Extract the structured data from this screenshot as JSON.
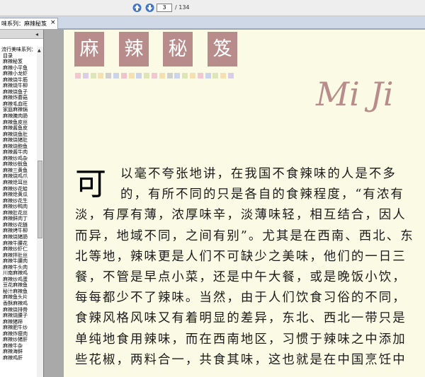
{
  "toolbar": {
    "page_current": "3",
    "page_total": "/ 134",
    "prev_icon": "up-arrow-icon",
    "next_icon": "down-arrow-icon"
  },
  "tab": {
    "label": "味系列：麻辣秘笈",
    "close": "×"
  },
  "sidebar": {
    "collapse": "◂",
    "items": [
      {
        "label": "流行美味系列："
      },
      {
        "label": "目录"
      },
      {
        "label": "麻辣秘笈"
      },
      {
        "label": "麻辣小平鱼"
      },
      {
        "label": "麻辣小龙虾"
      },
      {
        "label": "麻辣烧牛筋"
      },
      {
        "label": "麻辣烧牛柳"
      },
      {
        "label": "麻辣烧鱼子"
      },
      {
        "label": "麻辣炸蘑菇"
      },
      {
        "label": "麻辣毛血旺"
      },
      {
        "label": "家庭麻辣锅"
      },
      {
        "label": "麻辣腌肉肠"
      },
      {
        "label": "麻辣鱼皮丝"
      },
      {
        "label": "麻辣酱鱼皮"
      },
      {
        "label": "麻辣烧鱼肚"
      },
      {
        "label": "麻辣烧猪肚"
      },
      {
        "label": "麻辣烧鲍鱼"
      },
      {
        "label": "麻辣酱牛肉"
      },
      {
        "label": "麻辣炒鸡杂"
      },
      {
        "label": "麻辣炒鱿鱼"
      },
      {
        "label": "麻辣三黄鱼"
      },
      {
        "label": "麻辣烧鸡爪"
      },
      {
        "label": "麻辣炝耳丝"
      },
      {
        "label": "麻辣炒花蛤"
      },
      {
        "label": "麻辣炝黄瓜"
      },
      {
        "label": "麻辣炒花生"
      },
      {
        "label": "麻辣炒鸭肉"
      },
      {
        "label": "麻辣肚花丝"
      },
      {
        "label": "麻辣鲜肉丁"
      },
      {
        "label": "麻辣炒花鲢"
      },
      {
        "label": "麻辣烤牛柳"
      },
      {
        "label": "麻辣烧猪肠"
      },
      {
        "label": "麻辣牛腰花"
      },
      {
        "label": "麻辣炒虾仁"
      },
      {
        "label": "麻辣拌肚丝"
      },
      {
        "label": "麻辣牛腰肉"
      },
      {
        "label": "麻辣牛头肉"
      },
      {
        "label": "川南麻辣鸡"
      },
      {
        "label": "麻辣炒鸡蛋"
      },
      {
        "label": "豆花麻辣鱼"
      },
      {
        "label": "秘汁麻辣鱼"
      },
      {
        "label": "麻辣鱼头片"
      },
      {
        "label": "香酥麻辣鸡"
      },
      {
        "label": "麻辣烧排骨"
      },
      {
        "label": "麻辣烧腰子"
      },
      {
        "label": "麻辣猪蹄"
      },
      {
        "label": "麻辣肥牛炒"
      },
      {
        "label": "麻辣炸瘦肉"
      },
      {
        "label": "麻辣炒猪肝"
      },
      {
        "label": "麻辣牛杂"
      },
      {
        "label": "麻辣海鲜"
      },
      {
        "label": "麻辣鸡肝"
      }
    ]
  },
  "page": {
    "title_chars": [
      "麻",
      "辣",
      "秘",
      "笈"
    ],
    "title_color": "#b98c8c",
    "dot_colors": [
      "#f3c7cf",
      "#d9cdea",
      "#dce6b8",
      "#f6dfb0",
      "#d0d0d0",
      "#cbd4ea",
      "#f1c3cd",
      "#f6dfb0",
      "#cbd4ea",
      "#dce6b8",
      "#f3c7cf",
      "#f6dfb0",
      "#d0d0d0",
      "#cbd4ea",
      "#dce6b8",
      "#f6dfb0",
      "#f3c7cf",
      "#cbd4ea",
      "#dce6b8",
      "#f6dfb0",
      "#d9cdea"
    ],
    "script_text": "Mi Ji",
    "drop_cap": "可",
    "lines": [
      "以毫不夸张地讲，在我国不食辣味的人是不多",
      "的，有所不同的只是各自的食辣程度，“有浓有",
      "淡，有厚有薄，浓厚味辛，淡薄味轻，相互结合，因人",
      "而异，地域不同，之间有别”。尤其是在西南、西北、东",
      "北等地，辣味更是人们不可缺少之美味，他们的一日三",
      "餐，不管是早点小菜，还是中午大餐，或是晚饭小饮，",
      "每每都少不了辣味。当然，由于人们饮食习俗的不同，",
      "食辣风格风味又有着明显的差异，东北、西北一带只是",
      "单纯地食用辣味，而在西南地区，习惯于辣味之中添加",
      "些花椒，两料合一，共食其味，这也就是在中国烹饪中"
    ]
  }
}
